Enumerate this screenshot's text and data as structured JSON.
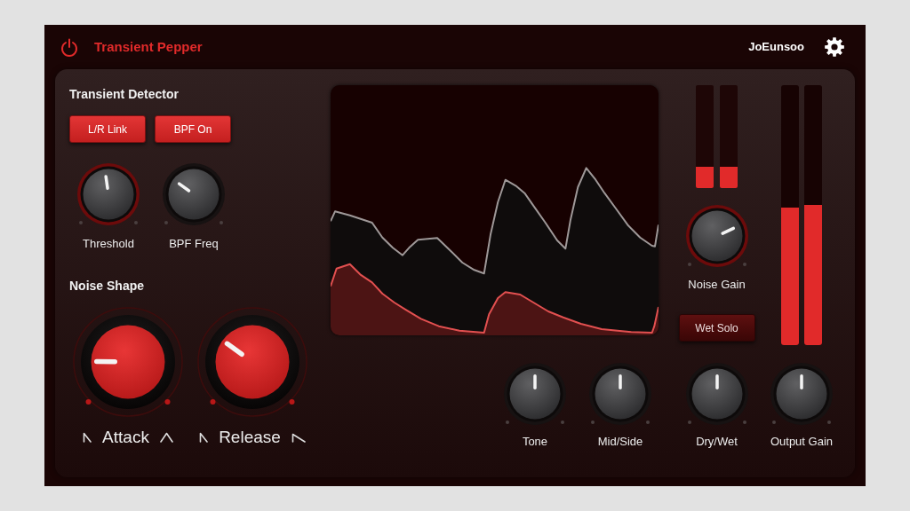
{
  "header": {
    "title": "Transient Pepper",
    "user": "JoEunsoo"
  },
  "transient_detector": {
    "title": "Transient Detector",
    "buttons": [
      {
        "label": "L/R Link",
        "on": true
      },
      {
        "label": "BPF On",
        "on": true
      }
    ],
    "knobs": [
      {
        "label": "Threshold",
        "level": 0.47,
        "highlighted": true
      },
      {
        "label": "BPF Freq",
        "level": 0.3,
        "highlighted": false
      }
    ]
  },
  "noise_shape": {
    "title": "Noise Shape",
    "knobs": [
      {
        "kind": "attack",
        "label": "Attack",
        "level": 0.17
      },
      {
        "kind": "release",
        "label": "Release",
        "level": 0.3
      }
    ]
  },
  "noise_meters": [
    {
      "level": 0.21
    },
    {
      "level": 0.21
    }
  ],
  "noise_gain": {
    "label": "Noise Gain",
    "level": 0.74,
    "highlighted": true
  },
  "wet_solo": {
    "label": "Wet Solo",
    "on": false
  },
  "output_meters": [
    {
      "level": 0.53
    },
    {
      "level": 0.54
    }
  ],
  "bottom_knobs": [
    {
      "label": "Tone",
      "level": 0.5,
      "highlighted": false
    },
    {
      "label": "Mid/Side",
      "level": 0.5,
      "highlighted": false
    },
    {
      "label": "Dry/Wet",
      "level": 0.5,
      "highlighted": false
    },
    {
      "label": "Output Gain",
      "level": 0.5,
      "highlighted": false
    }
  ]
}
